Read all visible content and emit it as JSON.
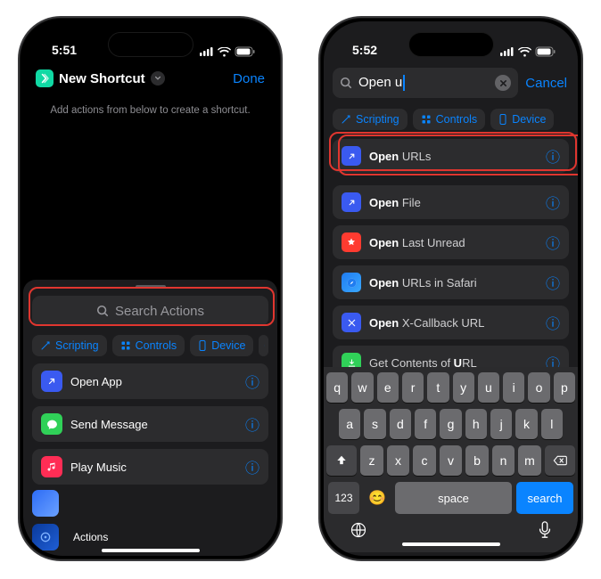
{
  "left": {
    "time": "5:51",
    "title": "New Shortcut",
    "done_label": "Done",
    "hint": "Add actions from below to create a shortcut.",
    "search_placeholder": "Search Actions",
    "chips": {
      "scripting": "Scripting",
      "controls": "Controls",
      "device": "Device"
    },
    "actions": {
      "open_app": "Open App",
      "send_message": "Send Message",
      "play_music": "Play Music"
    },
    "actions_label": "Actions"
  },
  "right": {
    "time": "5:52",
    "search_value": "Open u",
    "cancel_label": "Cancel",
    "chips": {
      "scripting": "Scripting",
      "controls": "Controls",
      "device": "Device"
    },
    "results": {
      "r0": {
        "bold": "Open",
        "rest": " URLs"
      },
      "r1": {
        "bold": "Open",
        "rest": " File"
      },
      "r2": {
        "bold": "Open",
        "rest": " Last Unread"
      },
      "r3": {
        "bold": "Open",
        "rest": " URLs in Safari"
      },
      "r4": {
        "bold": "Open",
        "rest": " X-Callback URL"
      },
      "r5": {
        "plain": "Get Contents of ",
        "bold": "U",
        "rest": "RL"
      }
    },
    "keyboard": {
      "row1": [
        "q",
        "w",
        "e",
        "r",
        "t",
        "y",
        "u",
        "i",
        "o",
        "p"
      ],
      "row2": [
        "a",
        "s",
        "d",
        "f",
        "g",
        "h",
        "j",
        "k",
        "l"
      ],
      "row3": [
        "z",
        "x",
        "c",
        "v",
        "b",
        "n",
        "m"
      ],
      "space": "space",
      "search": "search",
      "numbers": "123"
    }
  }
}
